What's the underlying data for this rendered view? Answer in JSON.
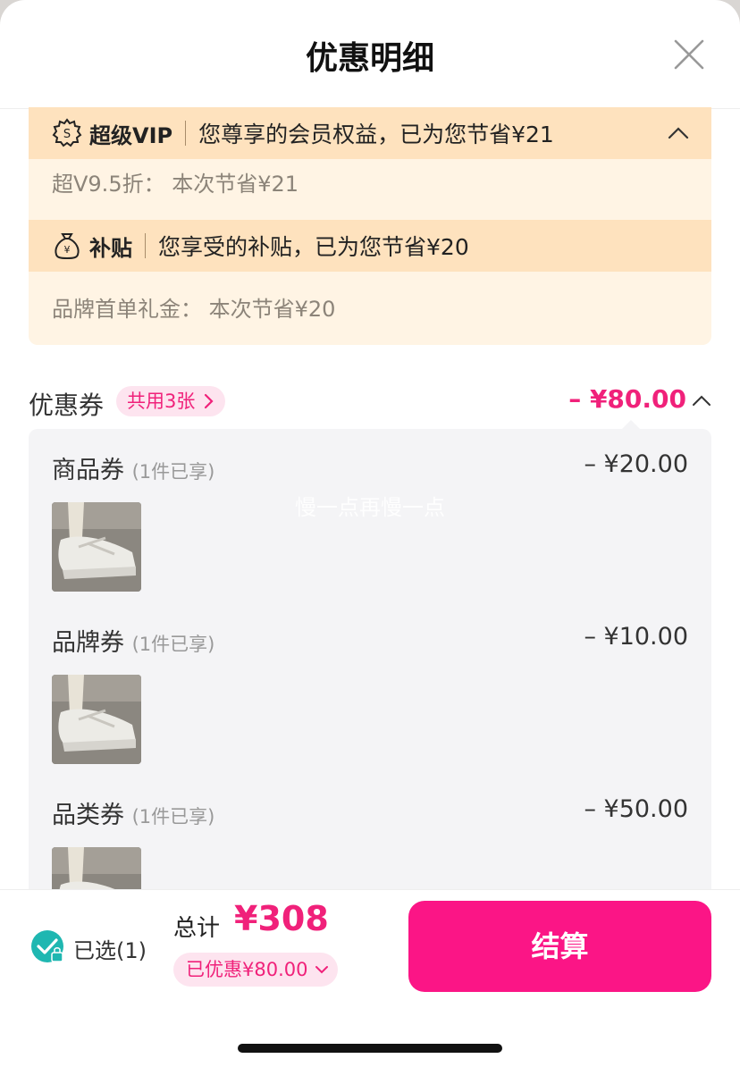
{
  "header": {
    "title": "优惠明细"
  },
  "vip": {
    "label": "超级VIP",
    "desc": "您尊享的会员权益，已为您节省¥21",
    "detail": "超V9.5折：  本次节省¥21"
  },
  "subsidy": {
    "label": "补贴",
    "desc": "您享受的补贴，已为您节省¥20",
    "detail": "品牌首单礼金：  本次节省¥20"
  },
  "coupons": {
    "title": "优惠券",
    "badge": "共用3张",
    "total": "– ¥80.00",
    "items": [
      {
        "name": "商品券",
        "note": "(1件已享)",
        "amount": "– ¥20.00"
      },
      {
        "name": "品牌券",
        "note": "(1件已享)",
        "amount": "– ¥10.00"
      },
      {
        "name": "品类券",
        "note": "(1件已享)",
        "amount": "– ¥50.00"
      }
    ]
  },
  "watermark": "慢一点再慢一点",
  "footer": {
    "selected": "已选(1)",
    "total_label": "总计",
    "total_value": "¥308",
    "discount": "已优惠¥80.00",
    "checkout": "结算"
  },
  "colors": {
    "accent": "#f0217a",
    "checkout_bg": "#fb1586",
    "vip_band": "#fee2be",
    "vip_bg": "#fff4e4",
    "check": "#1fb7b1"
  },
  "icons": [
    "close-icon",
    "vip-s-icon",
    "chevron-up-icon",
    "money-bag-icon",
    "chevron-right-icon",
    "chevron-down-icon",
    "check-lock-icon"
  ]
}
